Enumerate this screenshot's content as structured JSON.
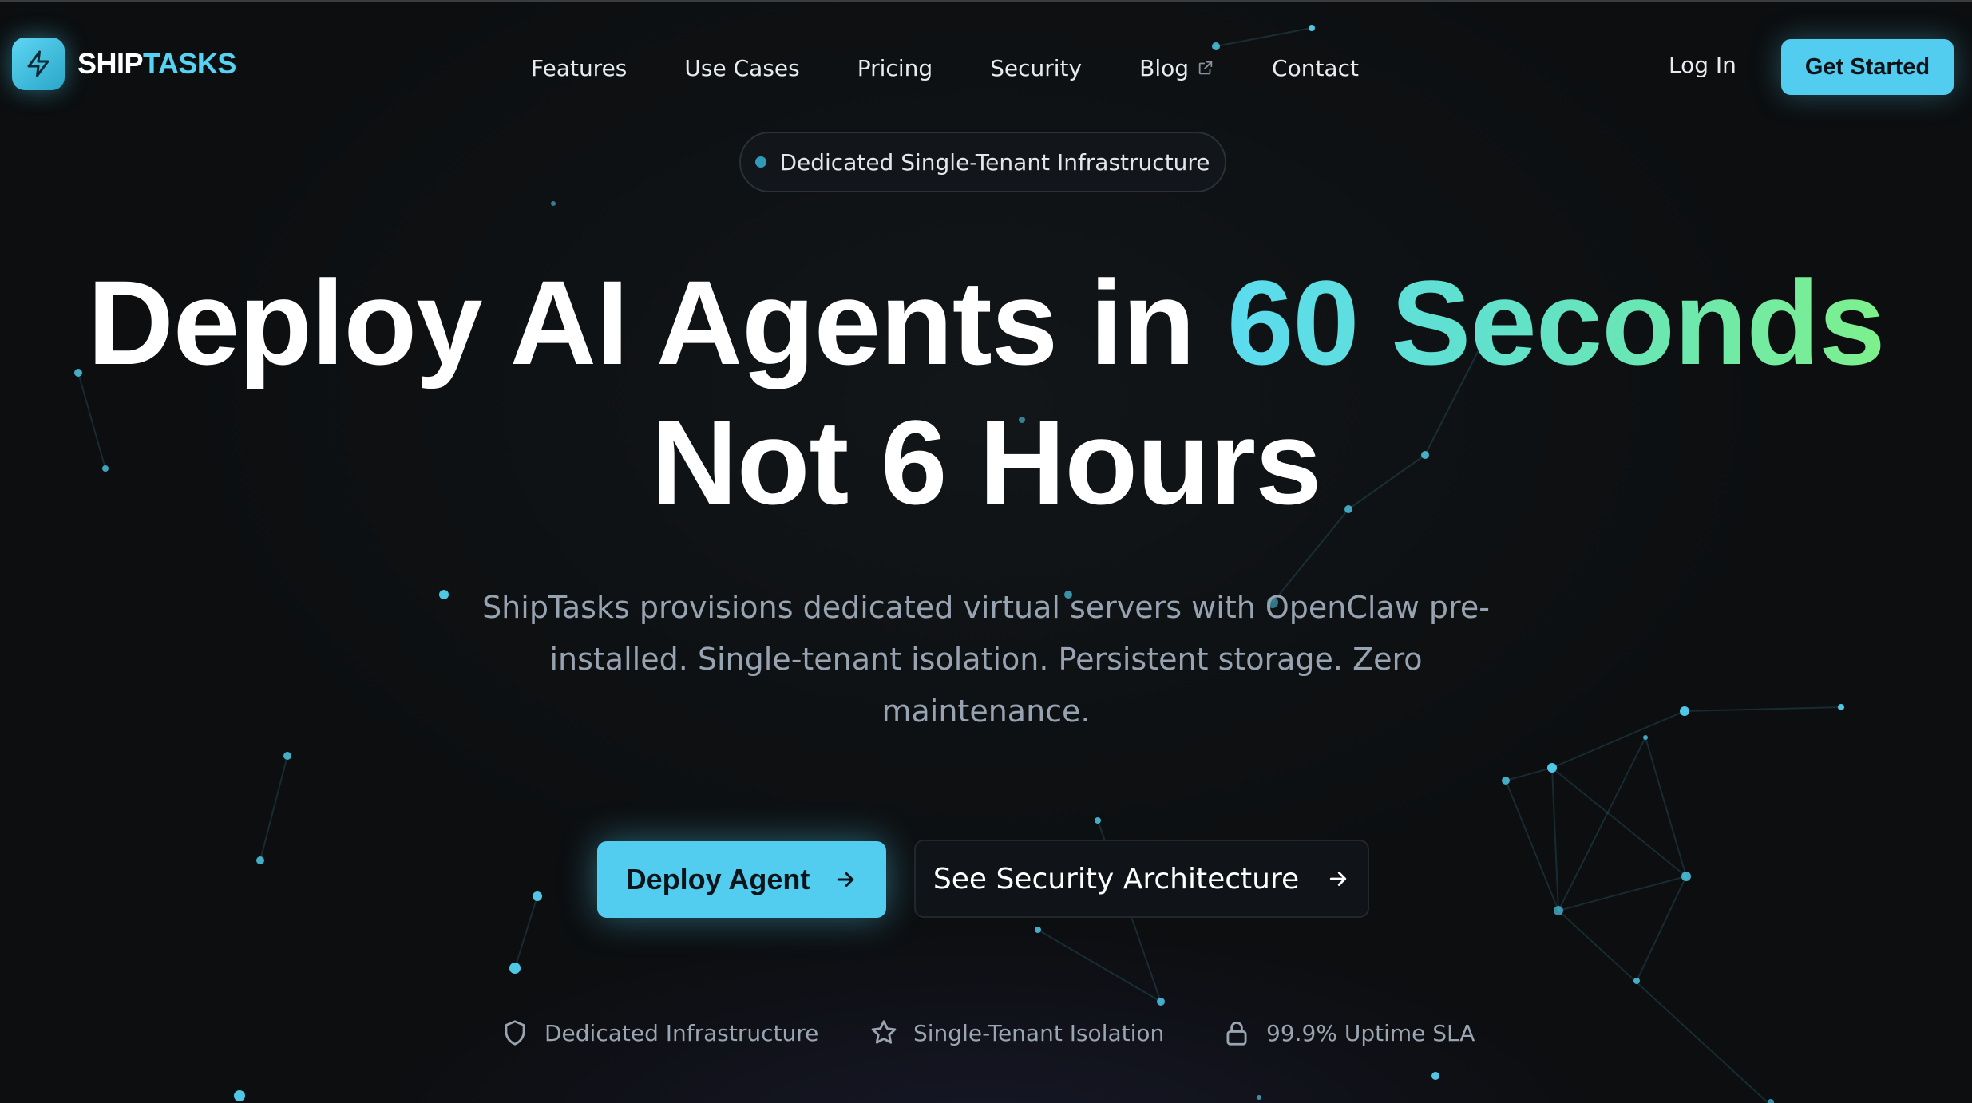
{
  "brand": {
    "name_part1": "SHIP",
    "name_part2": "TASKS",
    "icon": "lightning-bolt-icon",
    "accent": "#53cdef"
  },
  "nav": {
    "links": [
      {
        "label": "Features"
      },
      {
        "label": "Use Cases"
      },
      {
        "label": "Pricing"
      },
      {
        "label": "Security"
      },
      {
        "label": "Blog",
        "icon": "external-link-icon"
      },
      {
        "label": "Contact"
      }
    ],
    "login": "Log In",
    "cta": "Get Started"
  },
  "badge": {
    "text": "Dedicated Single-Tenant Infrastructure"
  },
  "hero": {
    "title_line1_plain": "Deploy AI Agents in ",
    "title_line1_highlight": "60 Seconds",
    "title_line2": "Not 6 Hours",
    "subtitle": "ShipTasks provisions dedicated virtual servers with OpenClaw pre-installed. Single-tenant isolation. Persistent storage. Zero maintenance.",
    "gradient_colors": [
      "#5bdbf0",
      "#63e3c2",
      "#7ef08c"
    ]
  },
  "actions": {
    "primary": {
      "label": "Deploy Agent",
      "icon": "arrow-right-icon"
    },
    "secondary": {
      "label": "See Security Architecture",
      "icon": "arrow-right-icon"
    }
  },
  "trust": [
    {
      "icon": "shield-icon",
      "label": "Dedicated Infrastructure"
    },
    {
      "icon": "star-icon",
      "label": "Single-Tenant Isolation"
    },
    {
      "icon": "lock-icon",
      "label": "99.9% Uptime SLA"
    }
  ],
  "colors": {
    "background": "#0c0e10",
    "node": "#4fc8e6",
    "muted_text": "#97a3b1"
  }
}
